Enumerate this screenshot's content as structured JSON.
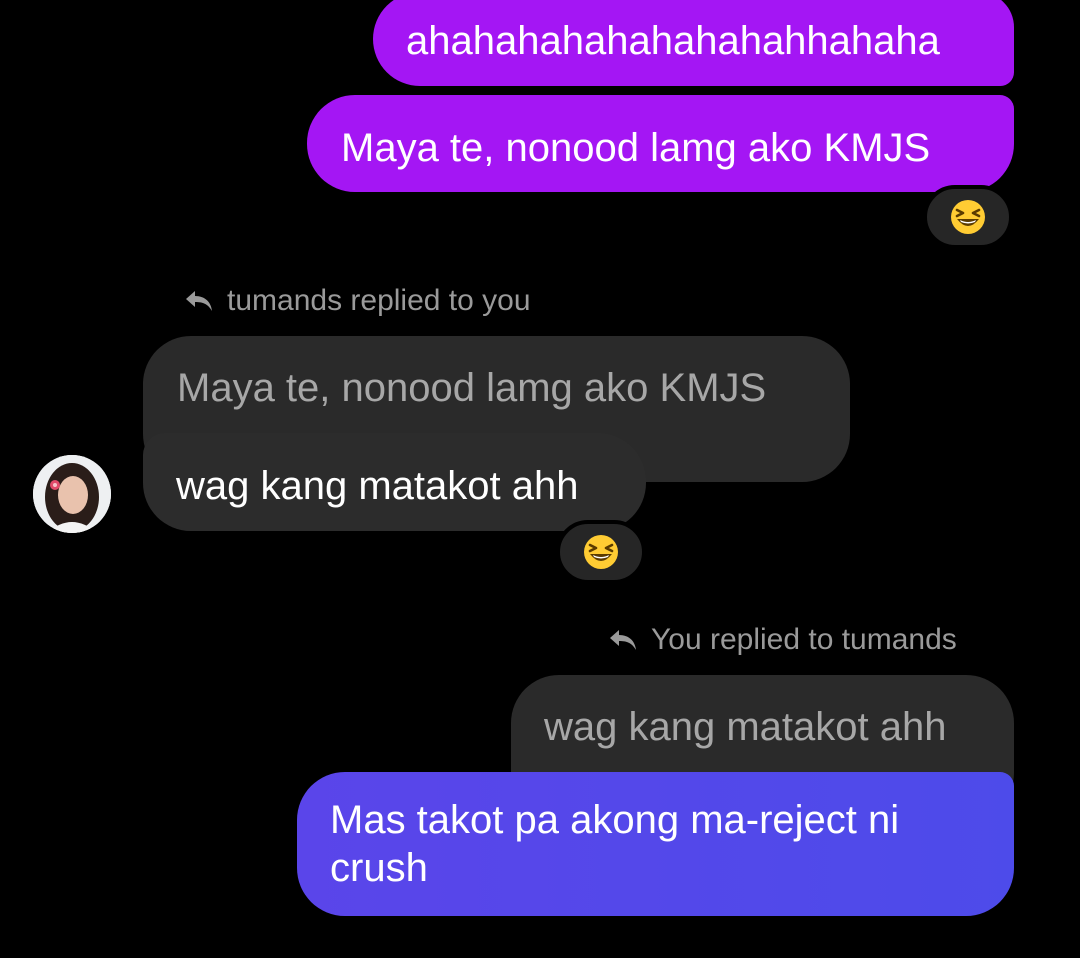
{
  "thread": {
    "msg1": "ahahahahahahahahahhahaha",
    "msg2": "Maya te, nonood lamg ako KMJS",
    "reply1_header": "tumands replied to you",
    "reply1_quote": "Maya te, nonood lamg ako KMJS",
    "reply1_text": "wag kang matakot ahh",
    "reply2_header": "You replied to tumands",
    "reply2_quote": "wag kang matakot ahh",
    "reply2_text_line1": "Mas takot pa akong ma-reject ni",
    "reply2_text_line2": "crush"
  },
  "reactions": {
    "reaction1": "laughing-squint-emoji",
    "reaction2": "laughing-squint-emoji"
  },
  "colors": {
    "background": "#000000",
    "my_bubble_purple": "#a416f4",
    "my_bubble_blue": "#5047ea",
    "their_bubble": "#2c2c2c",
    "quote_bubble": "#2a2a2a",
    "meta_text": "#9a9a9a"
  }
}
